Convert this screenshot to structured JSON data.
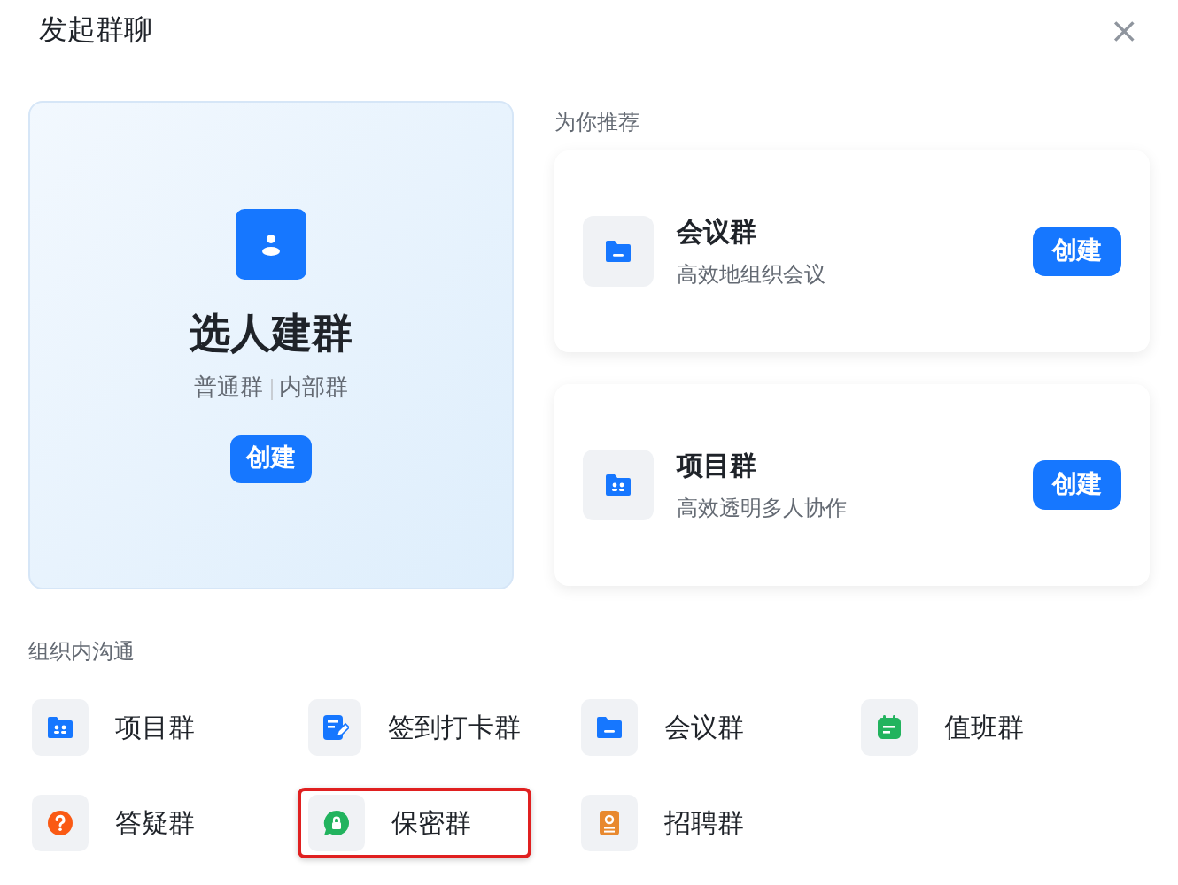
{
  "dialog": {
    "title": "发起群聊",
    "close": "×"
  },
  "main_card": {
    "title": "选人建群",
    "tags": [
      "普通群",
      "内部群"
    ],
    "button": "创建"
  },
  "recommended": {
    "heading": "为你推荐",
    "items": [
      {
        "title": "会议群",
        "subtitle": "高效地组织会议",
        "button": "创建"
      },
      {
        "title": "项目群",
        "subtitle": "高效透明多人协作",
        "button": "创建"
      }
    ]
  },
  "internal": {
    "heading": "组织内沟通",
    "items": [
      {
        "label": "项目群",
        "highlighted": false
      },
      {
        "label": "签到打卡群",
        "highlighted": false
      },
      {
        "label": "会议群",
        "highlighted": false
      },
      {
        "label": "值班群",
        "highlighted": false
      },
      {
        "label": "答疑群",
        "highlighted": false
      },
      {
        "label": "保密群",
        "highlighted": true
      },
      {
        "label": "招聘群",
        "highlighted": false
      }
    ]
  }
}
